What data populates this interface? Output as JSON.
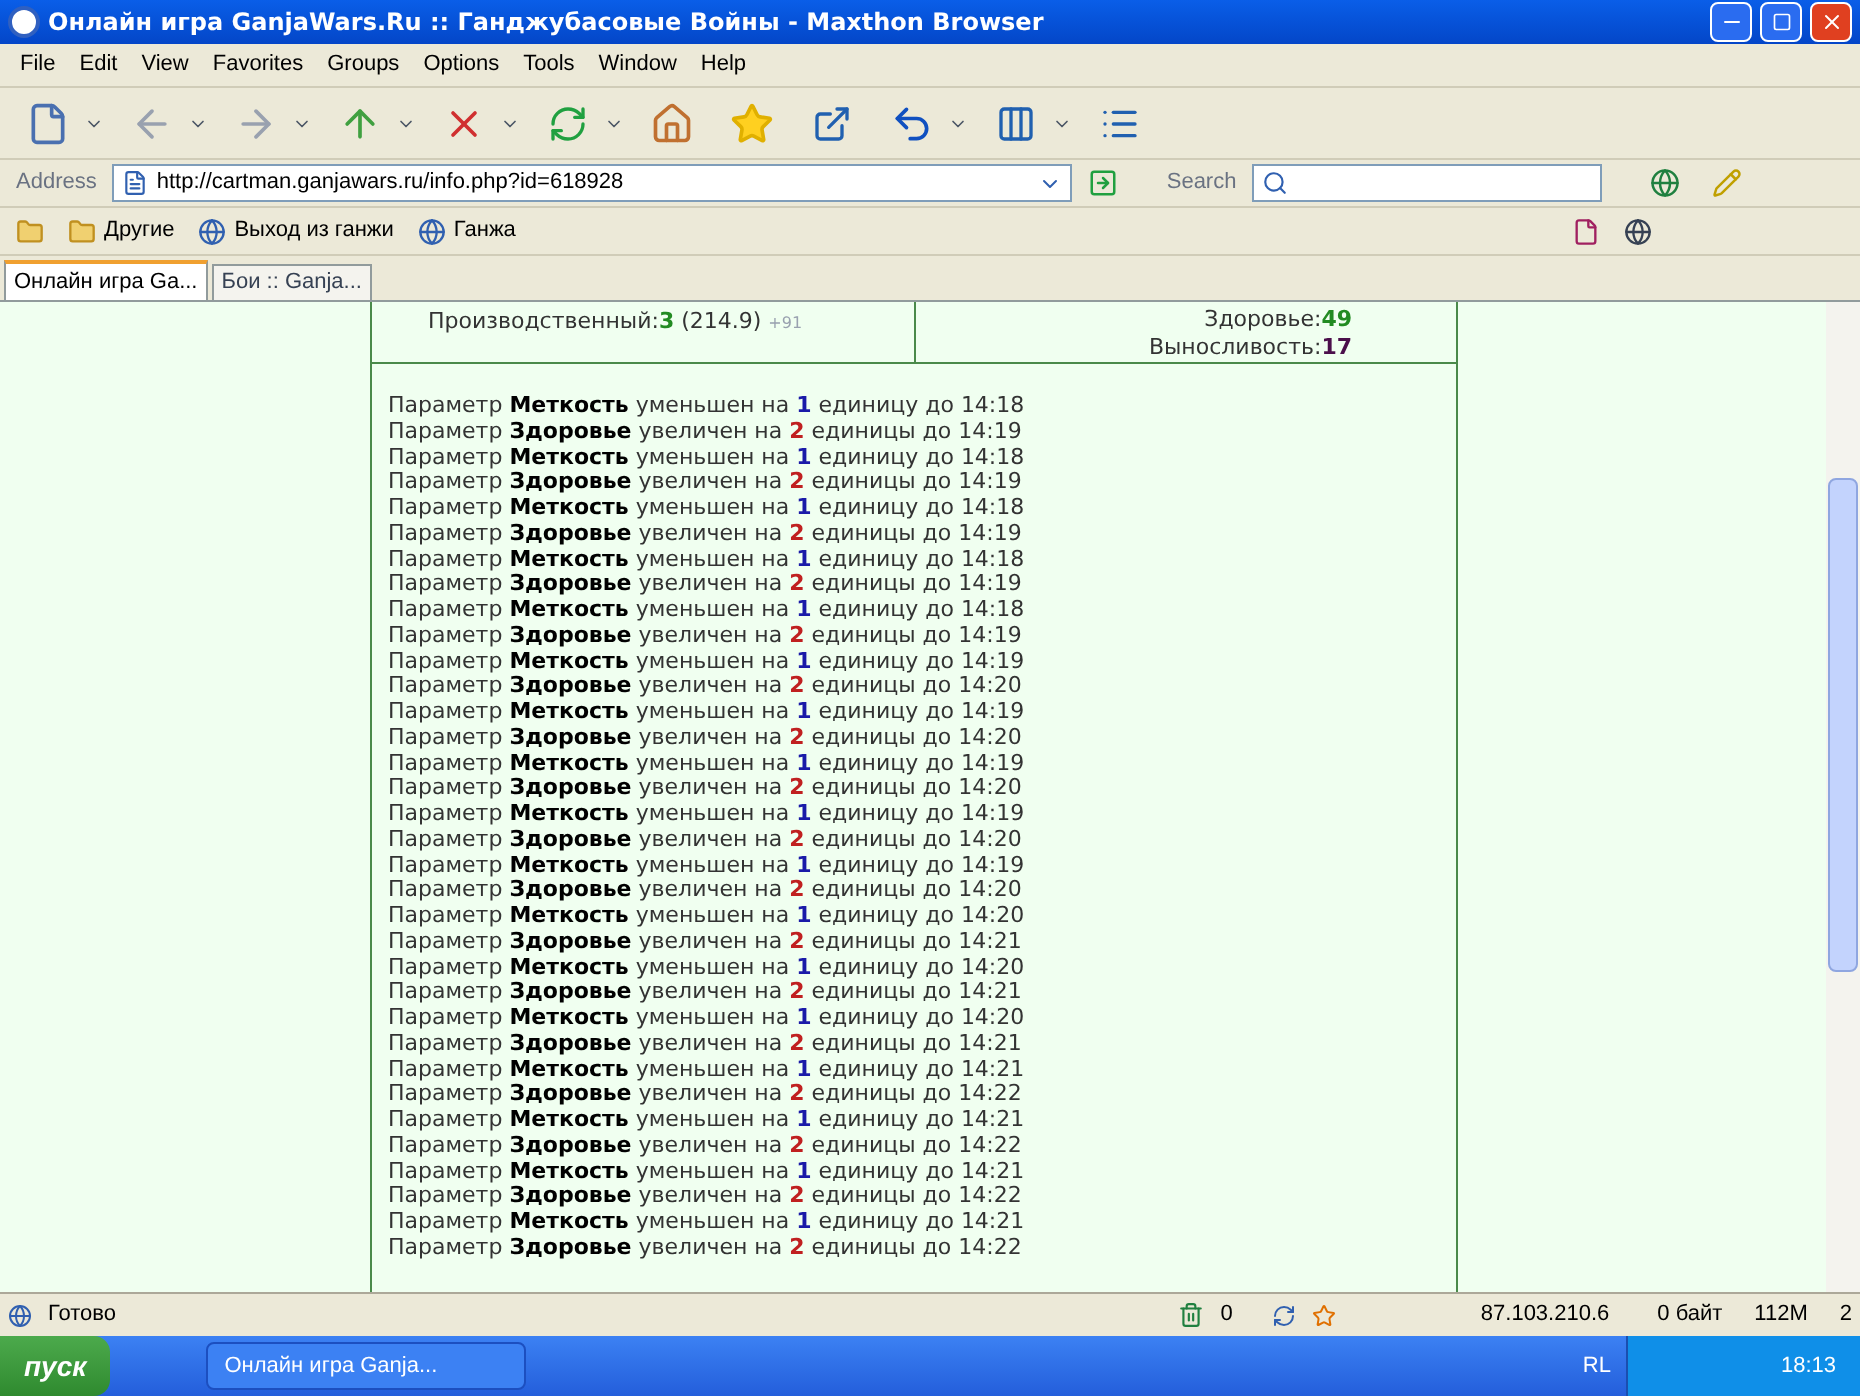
{
  "window": {
    "title": "Онлайн игра GanjaWars.Ru :: Ганджубасовые Войны - Maxthon Browser"
  },
  "menu": [
    "File",
    "Edit",
    "View",
    "Favorites",
    "Groups",
    "Options",
    "Tools",
    "Window",
    "Help"
  ],
  "address_bar": {
    "label": "Address",
    "value": "http://cartman.ganjawars.ru/info.php?id=618928",
    "search_label": "Search"
  },
  "links_bar": [
    "Другие",
    "Выход из ганжи",
    "Ганжа"
  ],
  "tabs": [
    {
      "label": "Онлайн игра Ga...",
      "selected": true
    },
    {
      "label": "Бои :: Ganja...",
      "selected": false
    }
  ],
  "stats": {
    "left": {
      "label": "Производственный:",
      "value": "3",
      "extra": "(214.9)",
      "bonus": "+91"
    },
    "right": [
      {
        "label": "Здоровье:",
        "value": "49",
        "color": "#228b22"
      },
      {
        "label": "Выносливость:",
        "value": "17",
        "color": "#4b0f4b"
      }
    ]
  },
  "log": [
    {
      "kind": "decrease",
      "prefix": "Параметр",
      "param": "Меткость",
      "verb": "уменьшен на",
      "amount": "1",
      "rest": "единицу до 14:18"
    },
    {
      "kind": "increase",
      "prefix": "Параметр",
      "param": "Здоровье",
      "verb": "увеличен на",
      "amount": "2",
      "rest": "единицы до 14:19"
    },
    {
      "kind": "decrease",
      "prefix": "Параметр",
      "param": "Меткость",
      "verb": "уменьшен на",
      "amount": "1",
      "rest": "единицу до 14:18"
    },
    {
      "kind": "increase",
      "prefix": "Параметр",
      "param": "Здоровье",
      "verb": "увеличен на",
      "amount": "2",
      "rest": "единицы до 14:19"
    },
    {
      "kind": "decrease",
      "prefix": "Параметр",
      "param": "Меткость",
      "verb": "уменьшен на",
      "amount": "1",
      "rest": "единицу до 14:18"
    },
    {
      "kind": "increase",
      "prefix": "Параметр",
      "param": "Здоровье",
      "verb": "увеличен на",
      "amount": "2",
      "rest": "единицы до 14:19"
    },
    {
      "kind": "decrease",
      "prefix": "Параметр",
      "param": "Меткость",
      "verb": "уменьшен на",
      "amount": "1",
      "rest": "единицу до 14:18"
    },
    {
      "kind": "increase",
      "prefix": "Параметр",
      "param": "Здоровье",
      "verb": "увеличен на",
      "amount": "2",
      "rest": "единицы до 14:19"
    },
    {
      "kind": "decrease",
      "prefix": "Параметр",
      "param": "Меткость",
      "verb": "уменьшен на",
      "amount": "1",
      "rest": "единицу до 14:18"
    },
    {
      "kind": "increase",
      "prefix": "Параметр",
      "param": "Здоровье",
      "verb": "увеличен на",
      "amount": "2",
      "rest": "единицы до 14:19"
    },
    {
      "kind": "decrease",
      "prefix": "Параметр",
      "param": "Меткость",
      "verb": "уменьшен на",
      "amount": "1",
      "rest": "единицу до 14:19"
    },
    {
      "kind": "increase",
      "prefix": "Параметр",
      "param": "Здоровье",
      "verb": "увеличен на",
      "amount": "2",
      "rest": "единицы до 14:20"
    },
    {
      "kind": "decrease",
      "prefix": "Параметр",
      "param": "Меткость",
      "verb": "уменьшен на",
      "amount": "1",
      "rest": "единицу до 14:19"
    },
    {
      "kind": "increase",
      "prefix": "Параметр",
      "param": "Здоровье",
      "verb": "увеличен на",
      "amount": "2",
      "rest": "единицы до 14:20"
    },
    {
      "kind": "decrease",
      "prefix": "Параметр",
      "param": "Меткость",
      "verb": "уменьшен на",
      "amount": "1",
      "rest": "единицу до 14:19"
    },
    {
      "kind": "increase",
      "prefix": "Параметр",
      "param": "Здоровье",
      "verb": "увеличен на",
      "amount": "2",
      "rest": "единицы до 14:20"
    },
    {
      "kind": "decrease",
      "prefix": "Параметр",
      "param": "Меткость",
      "verb": "уменьшен на",
      "amount": "1",
      "rest": "единицу до 14:19"
    },
    {
      "kind": "increase",
      "prefix": "Параметр",
      "param": "Здоровье",
      "verb": "увеличен на",
      "amount": "2",
      "rest": "единицы до 14:20"
    },
    {
      "kind": "decrease",
      "prefix": "Параметр",
      "param": "Меткость",
      "verb": "уменьшен на",
      "amount": "1",
      "rest": "единицу до 14:19"
    },
    {
      "kind": "increase",
      "prefix": "Параметр",
      "param": "Здоровье",
      "verb": "увеличен на",
      "amount": "2",
      "rest": "единицы до 14:20"
    },
    {
      "kind": "decrease",
      "prefix": "Параметр",
      "param": "Меткость",
      "verb": "уменьшен на",
      "amount": "1",
      "rest": "единицу до 14:20"
    },
    {
      "kind": "increase",
      "prefix": "Параметр",
      "param": "Здоровье",
      "verb": "увеличен на",
      "amount": "2",
      "rest": "единицы до 14:21"
    },
    {
      "kind": "decrease",
      "prefix": "Параметр",
      "param": "Меткость",
      "verb": "уменьшен на",
      "amount": "1",
      "rest": "единицу до 14:20"
    },
    {
      "kind": "increase",
      "prefix": "Параметр",
      "param": "Здоровье",
      "verb": "увеличен на",
      "amount": "2",
      "rest": "единицы до 14:21"
    },
    {
      "kind": "decrease",
      "prefix": "Параметр",
      "param": "Меткость",
      "verb": "уменьшен на",
      "amount": "1",
      "rest": "единицу до 14:20"
    },
    {
      "kind": "increase",
      "prefix": "Параметр",
      "param": "Здоровье",
      "verb": "увеличен на",
      "amount": "2",
      "rest": "единицы до 14:21"
    },
    {
      "kind": "decrease",
      "prefix": "Параметр",
      "param": "Меткость",
      "verb": "уменьшен на",
      "amount": "1",
      "rest": "единицу до 14:21"
    },
    {
      "kind": "increase",
      "prefix": "Параметр",
      "param": "Здоровье",
      "verb": "увеличен на",
      "amount": "2",
      "rest": "единицы до 14:22"
    },
    {
      "kind": "decrease",
      "prefix": "Параметр",
      "param": "Меткость",
      "verb": "уменьшен на",
      "amount": "1",
      "rest": "единицу до 14:21"
    },
    {
      "kind": "increase",
      "prefix": "Параметр",
      "param": "Здоровье",
      "verb": "увеличен на",
      "amount": "2",
      "rest": "единицы до 14:22"
    },
    {
      "kind": "decrease",
      "prefix": "Параметр",
      "param": "Меткость",
      "verb": "уменьшен на",
      "amount": "1",
      "rest": "единицу до 14:21"
    },
    {
      "kind": "increase",
      "prefix": "Параметр",
      "param": "Здоровье",
      "verb": "увеличен на",
      "amount": "2",
      "rest": "единицы до 14:22"
    },
    {
      "kind": "decrease",
      "prefix": "Параметр",
      "param": "Меткость",
      "verb": "уменьшен на",
      "amount": "1",
      "rest": "единицу до 14:21"
    },
    {
      "kind": "increase",
      "prefix": "Параметр",
      "param": "Здоровье",
      "verb": "увеличен на",
      "amount": "2",
      "rest": "единицы до 14:22"
    }
  ],
  "status_bar": {
    "text": "Готово",
    "count": "0",
    "ip": "87.103.210.6",
    "traffic": "0 байт",
    "memory": "112M",
    "pages": "2"
  },
  "taskbar": {
    "start": "пуск",
    "task": "Онлайн игра Ganja...",
    "lang": "RL",
    "clock": "18:13"
  }
}
